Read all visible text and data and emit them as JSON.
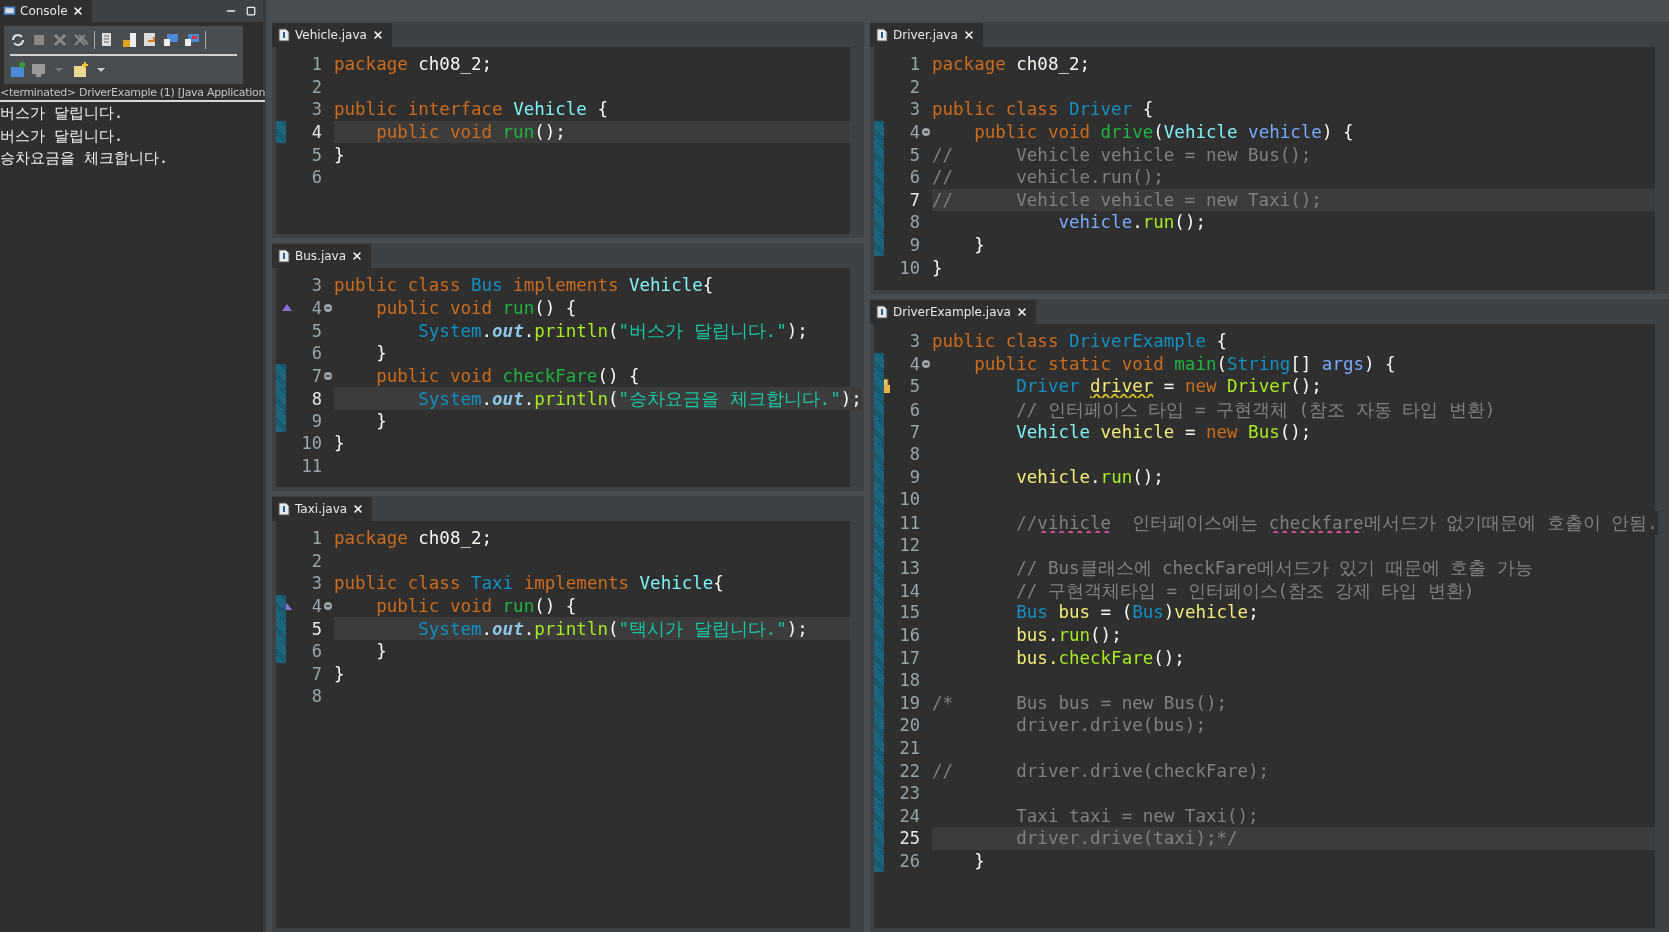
{
  "console": {
    "title": "Console",
    "process": "<terminated> DriverExample (1) [Java Application",
    "output": [
      "버스가 달립니다.",
      "버스가 달립니다.",
      "승차요금을 체크합니다."
    ]
  },
  "columns": [
    {
      "editors": [
        {
          "file": "Vehicle.java",
          "lines": [
            {
              "n": "1",
              "changed": false,
              "current": false,
              "fold": false,
              "tokens": [
                {
                  "kind": "kw",
                  "text": "package"
                },
                {
                  "kind": "p",
                  "text": " ch08_2;"
                }
              ]
            },
            {
              "n": "2",
              "changed": false,
              "current": false,
              "fold": false
            },
            {
              "n": "3",
              "changed": false,
              "current": false,
              "fold": false,
              "tokens": [
                {
                  "kind": "kw",
                  "text": "public interface "
                },
                {
                  "kind": "iface",
                  "text": "Vehicle"
                },
                {
                  "kind": "p",
                  "text": " {"
                }
              ]
            },
            {
              "n": "4",
              "changed": true,
              "current": true,
              "fold": false,
              "tokens": [
                {
                  "kind": "kw",
                  "text": "    public void "
                },
                {
                  "kind": "fn",
                  "text": "run"
                },
                {
                  "kind": "p",
                  "text": "();"
                }
              ]
            },
            {
              "n": "5",
              "changed": false,
              "current": false,
              "fold": false,
              "tokens": [
                {
                  "kind": "p",
                  "text": "}"
                }
              ]
            },
            {
              "n": "6",
              "changed": false,
              "current": false,
              "fold": false
            }
          ]
        },
        {
          "file": "Bus.java",
          "lines": [
            {
              "n": "3",
              "changed": false,
              "current": false,
              "fold": false,
              "tokens": [
                {
                  "kind": "kw",
                  "text": "public class "
                },
                {
                  "kind": "type",
                  "text": "Bus"
                },
                {
                  "kind": "kw",
                  "text": " implements "
                },
                {
                  "kind": "iface",
                  "text": "Vehicle"
                },
                {
                  "kind": "p",
                  "text": "{"
                }
              ]
            },
            {
              "n": "4",
              "changed": false,
              "current": false,
              "fold": true,
              "kind": "override",
              "tokens": [
                {
                  "kind": "kw",
                  "text": "    public void "
                },
                {
                  "kind": "fn",
                  "text": "run"
                },
                {
                  "kind": "p",
                  "text": "() {"
                }
              ]
            },
            {
              "n": "5",
              "changed": false,
              "current": false,
              "fold": false,
              "tokens": [
                {
                  "kind": "type",
                  "text": "        System"
                },
                {
                  "kind": "p",
                  "text": "."
                },
                {
                  "kind": "field",
                  "text": "out"
                },
                {
                  "kind": "p",
                  "text": "."
                },
                {
                  "kind": "call",
                  "text": "println"
                },
                {
                  "kind": "p",
                  "text": "("
                },
                {
                  "kind": "str",
                  "text": "\"버스가 달립니다.\""
                },
                {
                  "kind": "p",
                  "text": ");"
                }
              ]
            },
            {
              "n": "6",
              "changed": false,
              "current": false,
              "fold": false,
              "tokens": [
                {
                  "kind": "p",
                  "text": "    }"
                }
              ]
            },
            {
              "n": "7",
              "changed": true,
              "current": false,
              "fold": true,
              "tokens": [
                {
                  "kind": "kw",
                  "text": "    public void "
                },
                {
                  "kind": "fn",
                  "text": "checkFare"
                },
                {
                  "kind": "p",
                  "text": "() {"
                }
              ]
            },
            {
              "n": "8",
              "changed": true,
              "current": true,
              "fold": false,
              "tokens": [
                {
                  "kind": "type",
                  "text": "        System"
                },
                {
                  "kind": "p",
                  "text": "."
                },
                {
                  "kind": "field",
                  "text": "out"
                },
                {
                  "kind": "p",
                  "text": "."
                },
                {
                  "kind": "call",
                  "text": "println"
                },
                {
                  "kind": "p",
                  "text": "("
                },
                {
                  "kind": "str",
                  "text": "\"승차요금을 체크합니다.\""
                },
                {
                  "kind": "p",
                  "text": ");"
                }
              ]
            },
            {
              "n": "9",
              "changed": true,
              "current": false,
              "fold": false,
              "tokens": [
                {
                  "kind": "p",
                  "text": "    }"
                }
              ]
            },
            {
              "n": "10",
              "changed": false,
              "current": false,
              "fold": false,
              "tokens": [
                {
                  "kind": "p",
                  "text": "}"
                }
              ]
            },
            {
              "n": "11",
              "changed": false,
              "current": false,
              "fold": false
            }
          ]
        },
        {
          "file": "Taxi.java",
          "lines": [
            {
              "n": "1",
              "changed": false,
              "current": false,
              "fold": false,
              "tokens": [
                {
                  "kind": "kw",
                  "text": "package"
                },
                {
                  "kind": "p",
                  "text": " ch08_2;"
                }
              ]
            },
            {
              "n": "2",
              "changed": false,
              "current": false,
              "fold": false
            },
            {
              "n": "3",
              "changed": false,
              "current": false,
              "fold": false,
              "tokens": [
                {
                  "kind": "kw",
                  "text": "public class "
                },
                {
                  "kind": "type",
                  "text": "Taxi"
                },
                {
                  "kind": "kw",
                  "text": " implements "
                },
                {
                  "kind": "iface",
                  "text": "Vehicle"
                },
                {
                  "kind": "p",
                  "text": "{"
                }
              ]
            },
            {
              "n": "4",
              "changed": true,
              "current": false,
              "fold": true,
              "kind": "override",
              "tokens": [
                {
                  "kind": "kw",
                  "text": "    public void "
                },
                {
                  "kind": "fn",
                  "text": "run"
                },
                {
                  "kind": "p",
                  "text": "() {"
                }
              ]
            },
            {
              "n": "5",
              "changed": true,
              "current": true,
              "fold": false,
              "tokens": [
                {
                  "kind": "type",
                  "text": "        System"
                },
                {
                  "kind": "p",
                  "text": "."
                },
                {
                  "kind": "field",
                  "text": "out"
                },
                {
                  "kind": "p",
                  "text": "."
                },
                {
                  "kind": "call",
                  "text": "println"
                },
                {
                  "kind": "p",
                  "text": "("
                },
                {
                  "kind": "str",
                  "text": "\"택시가 달립니다.\""
                },
                {
                  "kind": "p",
                  "text": ");"
                }
              ]
            },
            {
              "n": "6",
              "changed": true,
              "current": false,
              "fold": false,
              "tokens": [
                {
                  "kind": "p",
                  "text": "    }"
                }
              ]
            },
            {
              "n": "7",
              "changed": false,
              "current": false,
              "fold": false,
              "tokens": [
                {
                  "kind": "p",
                  "text": "}"
                }
              ]
            },
            {
              "n": "8",
              "changed": false,
              "current": false,
              "fold": false
            }
          ]
        }
      ]
    },
    {
      "editors": [
        {
          "file": "Driver.java",
          "lines": [
            {
              "n": "1",
              "changed": false,
              "current": false,
              "fold": false,
              "tokens": [
                {
                  "kind": "kw",
                  "text": "package"
                },
                {
                  "kind": "p",
                  "text": " ch08_2;"
                }
              ]
            },
            {
              "n": "2",
              "changed": false,
              "current": false,
              "fold": false
            },
            {
              "n": "3",
              "changed": false,
              "current": false,
              "fold": false,
              "tokens": [
                {
                  "kind": "kw",
                  "text": "public class "
                },
                {
                  "kind": "type",
                  "text": "Driver"
                },
                {
                  "kind": "p",
                  "text": " {"
                }
              ]
            },
            {
              "n": "4",
              "changed": true,
              "current": false,
              "fold": true,
              "tokens": [
                {
                  "kind": "kw",
                  "text": "    public void "
                },
                {
                  "kind": "fn",
                  "text": "drive"
                },
                {
                  "kind": "p",
                  "text": "("
                },
                {
                  "kind": "iface",
                  "text": "Vehicle"
                },
                {
                  "kind": "param",
                  "text": " vehicle"
                },
                {
                  "kind": "p",
                  "text": ") {"
                }
              ]
            },
            {
              "n": "5",
              "changed": true,
              "current": false,
              "fold": false,
              "tokens": [
                {
                  "kind": "cm",
                  "text": "//      Vehicle vehicle = new Bus();"
                }
              ]
            },
            {
              "n": "6",
              "changed": true,
              "current": false,
              "fold": false,
              "tokens": [
                {
                  "kind": "cm",
                  "text": "//      vehicle.run();"
                }
              ]
            },
            {
              "n": "7",
              "changed": true,
              "current": true,
              "fold": false,
              "tokens": [
                {
                  "kind": "cm",
                  "text": "//      Vehicle vehicle = new Taxi();"
                }
              ]
            },
            {
              "n": "8",
              "changed": true,
              "current": false,
              "fold": false,
              "tokens": [
                {
                  "kind": "param",
                  "text": "            vehicle"
                },
                {
                  "kind": "p",
                  "text": "."
                },
                {
                  "kind": "call",
                  "text": "run"
                },
                {
                  "kind": "p",
                  "text": "();"
                }
              ]
            },
            {
              "n": "9",
              "changed": true,
              "current": false,
              "fold": false,
              "tokens": [
                {
                  "kind": "p",
                  "text": "    }"
                }
              ]
            },
            {
              "n": "10",
              "changed": false,
              "current": false,
              "fold": false,
              "tokens": [
                {
                  "kind": "p",
                  "text": "}"
                }
              ]
            }
          ]
        },
        {
          "file": "DriverExample.java",
          "lines": [
            {
              "n": "3",
              "changed": false,
              "current": false,
              "fold": false,
              "tokens": [
                {
                  "kind": "kw",
                  "text": "public class "
                },
                {
                  "kind": "type",
                  "text": "DriverExample"
                },
                {
                  "kind": "p",
                  "text": " {"
                }
              ]
            },
            {
              "n": "4",
              "changed": true,
              "current": false,
              "fold": true,
              "tokens": [
                {
                  "kind": "kw",
                  "text": "    public static void "
                },
                {
                  "kind": "fn",
                  "text": "main"
                },
                {
                  "kind": "p",
                  "text": "("
                },
                {
                  "kind": "type",
                  "text": "String"
                },
                {
                  "kind": "p",
                  "text": "[] "
                },
                {
                  "kind": "param",
                  "text": "args"
                },
                {
                  "kind": "p",
                  "text": ") {"
                }
              ]
            },
            {
              "n": "5",
              "changed": true,
              "current": false,
              "fold": false,
              "kind": "warning",
              "tokens": [
                {
                  "kind": "type",
                  "text": "        Driver "
                },
                {
                  "kind": "var-warning",
                  "text": "driver"
                },
                {
                  "kind": "p",
                  "text": " = "
                },
                {
                  "kind": "kw",
                  "text": "new "
                },
                {
                  "kind": "call",
                  "text": "Driver"
                },
                {
                  "kind": "p",
                  "text": "();"
                }
              ]
            },
            {
              "n": "6",
              "changed": true,
              "current": false,
              "fold": false,
              "tokens": [
                {
                  "kind": "cm",
                  "text": "        // 인터페이스 타입 = 구현객체 (참조 자동 타입 변환)"
                }
              ]
            },
            {
              "n": "7",
              "changed": true,
              "current": false,
              "fold": false,
              "tokens": [
                {
                  "kind": "iface",
                  "text": "        Vehicle "
                },
                {
                  "kind": "var",
                  "text": "vehicle"
                },
                {
                  "kind": "p",
                  "text": " = "
                },
                {
                  "kind": "kw",
                  "text": "new "
                },
                {
                  "kind": "call",
                  "text": "Bus"
                },
                {
                  "kind": "p",
                  "text": "();"
                }
              ]
            },
            {
              "n": "8",
              "changed": true,
              "current": false,
              "fold": false
            },
            {
              "n": "9",
              "changed": true,
              "current": false,
              "fold": false,
              "tokens": [
                {
                  "kind": "var",
                  "text": "        vehicle"
                },
                {
                  "kind": "p",
                  "text": "."
                },
                {
                  "kind": "call",
                  "text": "run"
                },
                {
                  "kind": "p",
                  "text": "();"
                }
              ]
            },
            {
              "n": "10",
              "changed": true,
              "current": false,
              "fold": false
            },
            {
              "n": "11",
              "changed": true,
              "current": false,
              "fold": false,
              "tokens": [
                {
                  "kind": "cm",
                  "text": "        //"
                },
                {
                  "kind": "cm-spelling",
                  "text": "vihicle"
                },
                {
                  "kind": "cm",
                  "text": "  인터페이스에는 "
                },
                {
                  "kind": "cm-spelling",
                  "text": "checkfare"
                },
                {
                  "kind": "cm",
                  "text": "메서드가 없기때문에 호출이 안됨."
                }
              ]
            },
            {
              "n": "12",
              "changed": true,
              "current": false,
              "fold": false
            },
            {
              "n": "13",
              "changed": true,
              "current": false,
              "fold": false,
              "tokens": [
                {
                  "kind": "cm",
                  "text": "        // Bus클래스에 checkFare메서드가 있기 때문에 호출 가능"
                }
              ]
            },
            {
              "n": "14",
              "changed": true,
              "current": false,
              "fold": false,
              "tokens": [
                {
                  "kind": "cm",
                  "text": "        // 구현객체타입 = 인터페이스(참조 강제 타입 변환)"
                }
              ]
            },
            {
              "n": "15",
              "changed": true,
              "current": false,
              "fold": false,
              "tokens": [
                {
                  "kind": "type",
                  "text": "        Bus "
                },
                {
                  "kind": "var",
                  "text": "bus"
                },
                {
                  "kind": "p",
                  "text": " = ("
                },
                {
                  "kind": "type",
                  "text": "Bus"
                },
                {
                  "kind": "p",
                  "text": ")"
                },
                {
                  "kind": "var",
                  "text": "vehicle"
                },
                {
                  "kind": "p",
                  "text": ";"
                }
              ]
            },
            {
              "n": "16",
              "changed": true,
              "current": false,
              "fold": false,
              "tokens": [
                {
                  "kind": "var",
                  "text": "        bus"
                },
                {
                  "kind": "p",
                  "text": "."
                },
                {
                  "kind": "call",
                  "text": "run"
                },
                {
                  "kind": "p",
                  "text": "();"
                }
              ]
            },
            {
              "n": "17",
              "changed": true,
              "current": false,
              "fold": false,
              "tokens": [
                {
                  "kind": "var",
                  "text": "        bus."
                },
                {
                  "kind": "call",
                  "text": "checkFare"
                },
                {
                  "kind": "p",
                  "text": "();"
                }
              ]
            },
            {
              "n": "18",
              "changed": true,
              "current": false,
              "fold": false
            },
            {
              "n": "19",
              "changed": true,
              "current": false,
              "fold": false,
              "tokens": [
                {
                  "kind": "cm",
                  "text": "/*      Bus bus = new Bus();"
                }
              ]
            },
            {
              "n": "20",
              "changed": true,
              "current": false,
              "fold": false,
              "tokens": [
                {
                  "kind": "cm",
                  "text": "        driver.drive(bus);"
                }
              ]
            },
            {
              "n": "21",
              "changed": true,
              "current": false,
              "fold": false
            },
            {
              "n": "22",
              "changed": true,
              "current": false,
              "fold": false,
              "tokens": [
                {
                  "kind": "cm",
                  "text": "//      driver.drive(checkFare);"
                }
              ]
            },
            {
              "n": "23",
              "changed": true,
              "current": false,
              "fold": false
            },
            {
              "n": "24",
              "changed": true,
              "current": false,
              "fold": false,
              "tokens": [
                {
                  "kind": "cm",
                  "text": "        Taxi taxi = new Taxi();"
                }
              ]
            },
            {
              "n": "25",
              "changed": true,
              "current": true,
              "fold": false,
              "tokens": [
                {
                  "kind": "cm",
                  "text": "        driver.drive(taxi);*/"
                }
              ]
            },
            {
              "n": "26",
              "changed": true,
              "current": false,
              "fold": false,
              "tokens": [
                {
                  "kind": "p",
                  "text": "    }"
                }
              ]
            }
          ]
        }
      ]
    }
  ]
}
